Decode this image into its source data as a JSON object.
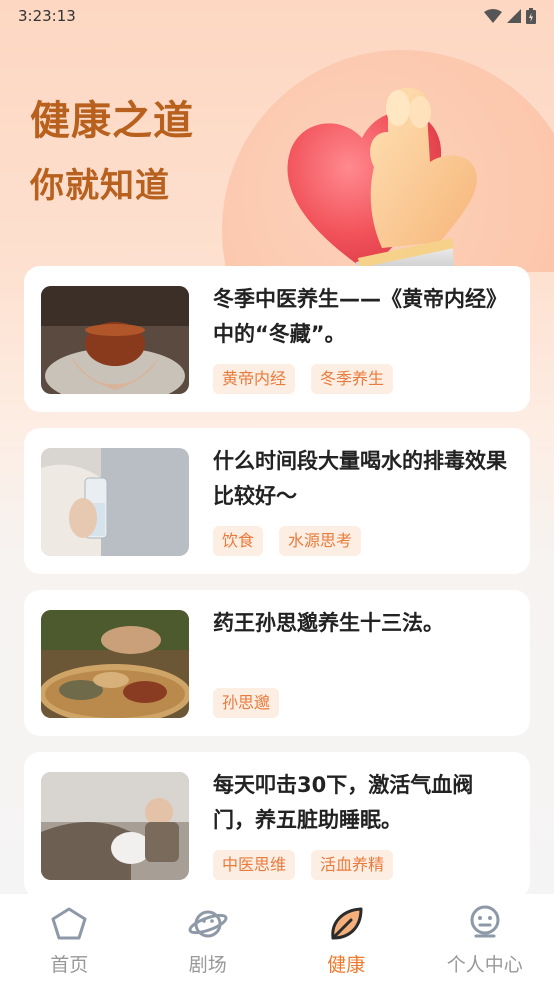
{
  "status_bar": {
    "time": "3:23:13"
  },
  "hero": {
    "title": "健康之道",
    "subtitle": "你就知道"
  },
  "articles": [
    {
      "title": "冬季中医养生——《黄帝内经》中的“冬藏”。",
      "tags": [
        "黄帝内经",
        "冬季养生"
      ]
    },
    {
      "title": "什么时间段大量喝水的排毒效果比较好～",
      "tags": [
        "饮食",
        "水源思考"
      ]
    },
    {
      "title": "药王孙思邈养生十三法。",
      "tags": [
        "孙思邈"
      ]
    },
    {
      "title": "每天叩击30下，激活气血阀门，养五脏助睡眠。",
      "tags": [
        "中医思维",
        "活血养精"
      ]
    }
  ],
  "tabbar": {
    "items": [
      {
        "label": "首页",
        "icon": "home-pentagon-icon"
      },
      {
        "label": "剧场",
        "icon": "theater-planet-icon"
      },
      {
        "label": "健康",
        "icon": "health-leaf-icon"
      },
      {
        "label": "个人中心",
        "icon": "profile-robot-icon"
      }
    ],
    "active_index": 2,
    "active_color": "#f07a2c",
    "inactive_color": "#999999"
  },
  "colors": {
    "accent": "#f07a2c",
    "hero_text": "#b8611f",
    "tag_bg": "#fdeee3",
    "tag_text": "#e97b3d"
  }
}
